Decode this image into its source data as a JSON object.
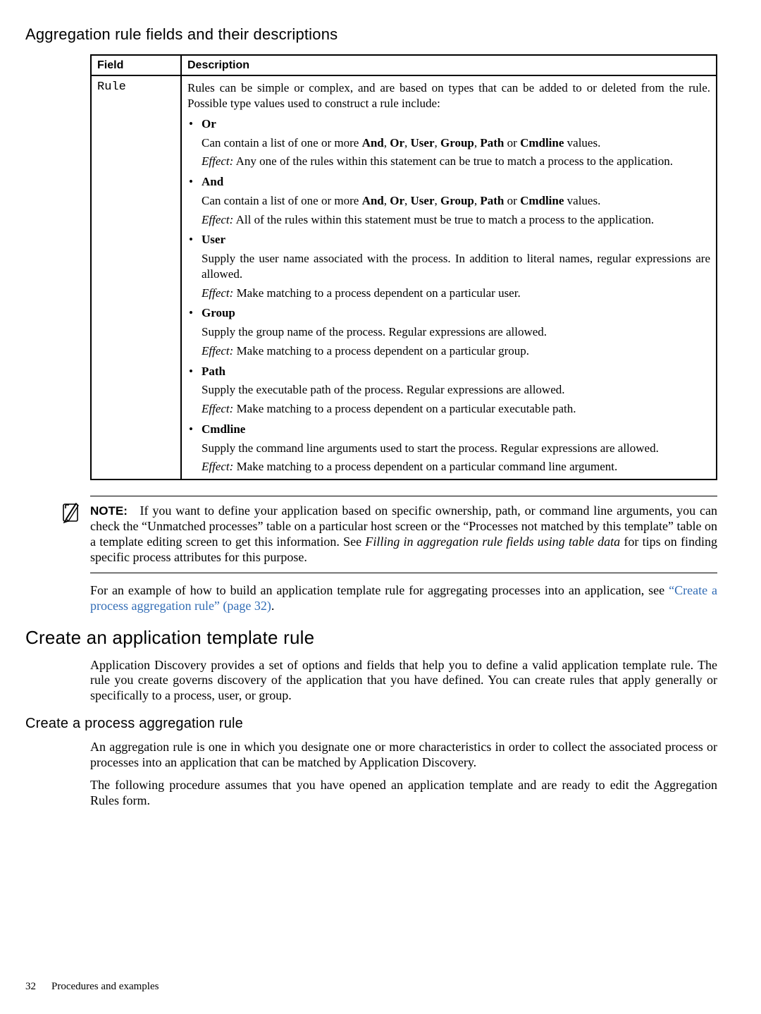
{
  "headings": {
    "h3_fields": "Aggregation rule fields and their descriptions",
    "h2_create_rule": "Create an application template rule",
    "h4_process_rule": "Create a process aggregation rule"
  },
  "table": {
    "headers": {
      "field": "Field",
      "description": "Description"
    },
    "row": {
      "field": "Rule",
      "lead": "Rules can be simple or complex, and are based on types that can be added to or deleted from the rule. Possible type values used to construct a rule include:",
      "effect_label": "Effect:",
      "types": [
        {
          "name": "Or",
          "body_pre": "Can contain a list of one or more ",
          "body_terms": [
            "And",
            "Or",
            "User",
            "Group",
            "Path",
            "Cmdline"
          ],
          "body_post": " values.",
          "effect": " Any one of the rules within this statement can be true to match a process to the application."
        },
        {
          "name": "And",
          "body_pre": "Can contain a list of one or more ",
          "body_terms": [
            "And",
            "Or",
            "User",
            "Group",
            "Path",
            "Cmdline"
          ],
          "body_post": " values.",
          "effect": " All of the rules within this statement must be true to match a process to the application."
        },
        {
          "name": "User",
          "body": "Supply the user name associated with the process. In addition to literal names, regular expressions are allowed.",
          "effect": " Make matching to a process dependent on a particular user."
        },
        {
          "name": "Group",
          "body": "Supply the group name of the process. Regular expressions are allowed.",
          "effect": " Make matching to a process dependent on a particular group."
        },
        {
          "name": "Path",
          "body": "Supply the executable path of the process. Regular expressions are allowed.",
          "effect": " Make matching to a process dependent on a particular executable path."
        },
        {
          "name": "Cmdline",
          "body": "Supply the command line arguments used to start the process. Regular expressions are allowed.",
          "effect": " Make matching to a process dependent on a particular command line argument."
        }
      ]
    }
  },
  "note": {
    "label": "NOTE:",
    "text_pre": "If you want to define your application based on specific ownership, path, or command line arguments, you can check the “Unmatched processes” table on a particular host screen or the “Processes not matched by this template” table on a template editing screen to get this information.  See ",
    "text_ital": "Filling in aggregation rule fields using table data",
    "text_post": " for tips on finding specific process attributes for this purpose."
  },
  "paras": {
    "example_pre": "For an example of how to build an application template rule for aggregating processes into an application, see ",
    "example_link": "“Create a process aggregation rule” (page 32)",
    "example_post": ".",
    "app_disc": "Application Discovery provides a set of options and fields that help you to define a valid application template rule. The rule you create governs discovery of the application that you have defined. You can create rules that apply generally or specifically to a process, user, or group.",
    "agg_rule": "An aggregation rule is one in which you designate one or more characteristics in order to collect the associated process or processes into an application that can be matched by Application Discovery.",
    "agg_rule2": "The following procedure assumes that you have opened an application template and are ready to edit the Aggregation Rules form."
  },
  "footer": {
    "page": "32",
    "section": "Procedures and examples"
  }
}
